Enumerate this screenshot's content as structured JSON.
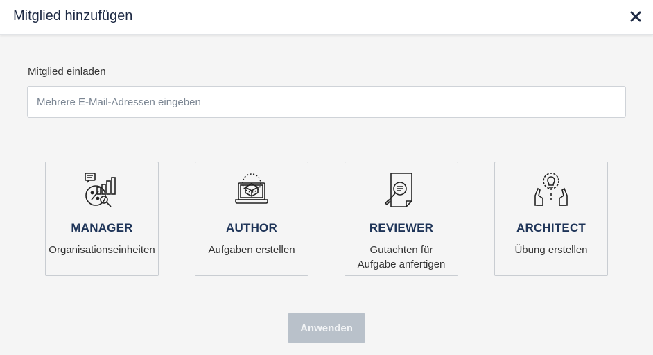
{
  "dialog": {
    "title": "Mitglied hinzufügen",
    "close_icon": "close-icon"
  },
  "invite": {
    "label": "Mitglied einladen",
    "value": "",
    "placeholder": "Mehrere E-Mail-Adressen eingeben"
  },
  "roles": [
    {
      "name": "MANAGER",
      "description": "Organisationseinheiten",
      "icon": "manager-analytics-icon"
    },
    {
      "name": "AUTHOR",
      "description": "Aufgaben erstellen",
      "icon": "author-laptop-icon"
    },
    {
      "name": "REVIEWER",
      "description": "Gutachten für\nAufgabe anfertigen",
      "icon": "reviewer-document-search-icon"
    },
    {
      "name": "ARCHITECT",
      "description": "Übung erstellen",
      "icon": "architect-idea-hands-icon"
    }
  ],
  "actions": {
    "apply_label": "Anwenden"
  },
  "colors": {
    "title": "#1e2a44",
    "role_name": "#1e3458",
    "apply_button_bg": "#b9c1ca",
    "background": "#f5f5f5"
  }
}
